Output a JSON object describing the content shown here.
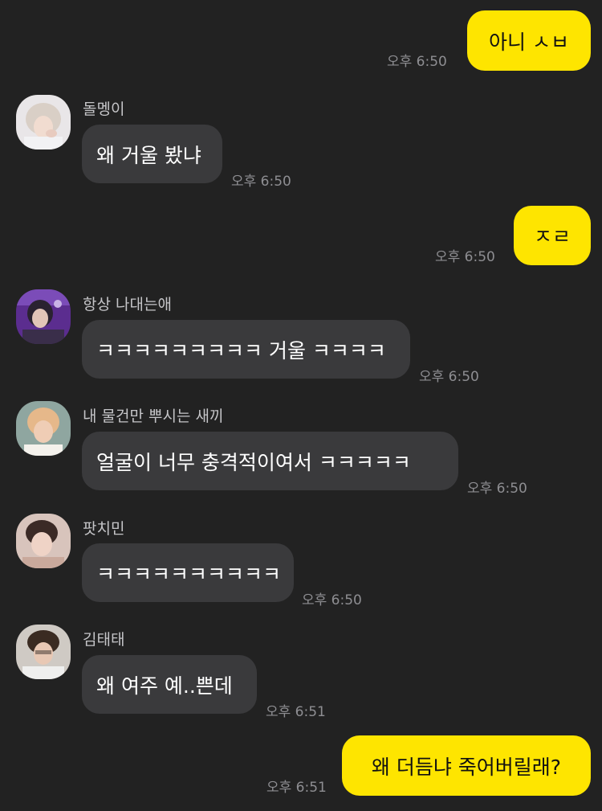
{
  "colors": {
    "background": "#222222",
    "outgoing_bubble": "#FEE500",
    "incoming_bubble": "#3a3a3c",
    "time_text": "#8e8e92",
    "name_text": "#c5c5c8"
  },
  "messages": [
    {
      "direction": "out",
      "text": "아니 ㅅㅂ",
      "time": "오후 6:50"
    },
    {
      "direction": "in",
      "sender": "돌멩이",
      "avatar": "avatar-photo",
      "text": "왜 거울 봤냐",
      "time": "오후 6:50"
    },
    {
      "direction": "out",
      "text": "ㅈㄹ",
      "time": "오후 6:50"
    },
    {
      "direction": "in",
      "sender": "항상 나대는애",
      "avatar": "avatar-photo",
      "text": "ㅋㅋㅋㅋㅋㅋㅋㅋㅋ 거울 ㅋㅋㅋㅋ",
      "time": "오후 6:50"
    },
    {
      "direction": "in",
      "sender": "내 물건만 뿌시는 새끼",
      "avatar": "avatar-photo",
      "text": "얼굴이 너무 충격적이여서 ㅋㅋㅋㅋㅋ",
      "time": "오후 6:50"
    },
    {
      "direction": "in",
      "sender": "팟치민",
      "avatar": "avatar-photo",
      "text": "ㅋㅋㅋㅋㅋㅋㅋㅋㅋㅋ",
      "time": "오후 6:50"
    },
    {
      "direction": "in",
      "sender": "김태태",
      "avatar": "avatar-photo",
      "text": "왜 여주 예..쁜데",
      "time": "오후 6:51"
    },
    {
      "direction": "out",
      "text": "왜 더듬냐 죽어버릴래?",
      "time": "오후 6:51"
    }
  ]
}
